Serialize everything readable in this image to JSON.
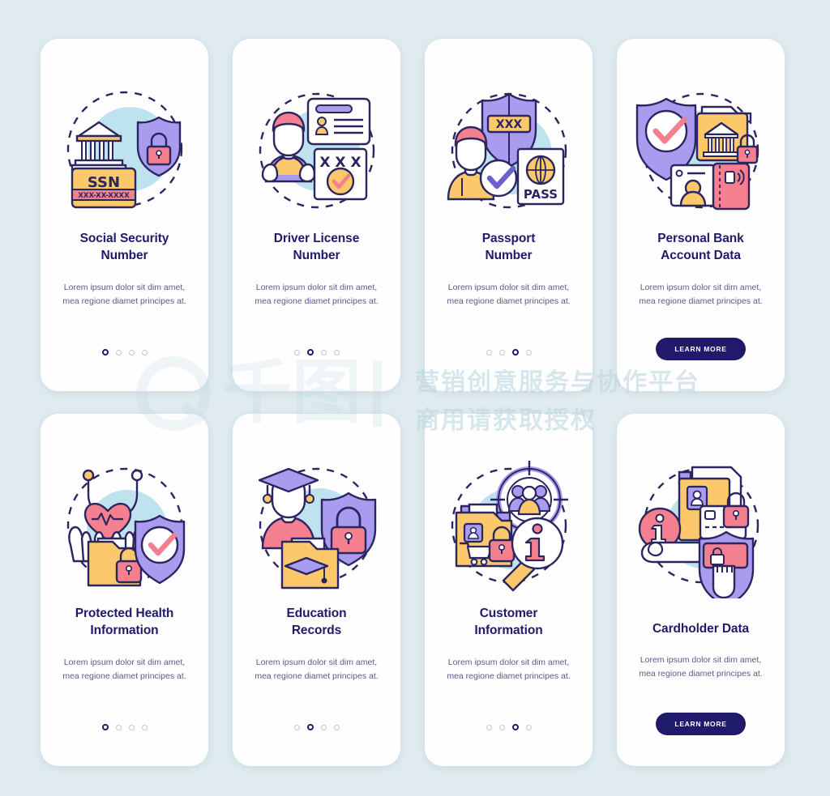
{
  "page": {
    "background_color": "#dfebef",
    "card_background": "#fefefe",
    "title_color": "#201a6b",
    "body_color": "#5b5a86",
    "accent_navy": "#201a6b",
    "accent_purple": "#9b8ee8",
    "accent_yellow": "#fbc96b",
    "accent_pink": "#f4808f",
    "accent_lightblue": "#bfe2ef"
  },
  "watermark": {
    "logo_text": "千图",
    "line1": "营销创意服务与协作平台",
    "line2": "商用请获取授权"
  },
  "shared": {
    "description": "Lorem ipsum dolor sit dim amet, mea regione diamet principes at.",
    "learn_more_label": "LEARN MORE",
    "dot_count": 4
  },
  "cards": [
    {
      "id": "social-security-number",
      "title": "Social Security Number",
      "title_lines": [
        "Social Security",
        "Number"
      ],
      "description": "Lorem ipsum dolor sit dim amet, mea regione diamet principes at.",
      "footer_type": "dots",
      "active_dot": 1,
      "illustration": "bank-ssn-card-shield-lock",
      "illustration_labels": [
        "SSN",
        "XXX-XX-XXXX"
      ]
    },
    {
      "id": "driver-license-number",
      "title": "Driver License Number",
      "title_lines": [
        "Driver License",
        "Number"
      ],
      "description": "Lorem ipsum dolor sit dim amet, mea regione diamet principes at.",
      "footer_type": "dots",
      "active_dot": 2,
      "illustration": "person-id-card-xxx-check",
      "illustration_labels": [
        "X X X"
      ]
    },
    {
      "id": "passport-number",
      "title": "Passport Number",
      "title_lines": [
        "Passport",
        "Number"
      ],
      "description": "Lorem ipsum dolor sit dim amet, mea regione diamet principes at.",
      "footer_type": "dots",
      "active_dot": 3,
      "illustration": "person-shield-xxx-passport",
      "illustration_labels": [
        "XXX",
        "PASS"
      ]
    },
    {
      "id": "personal-bank-account-data",
      "title": "Personal Bank Account Data",
      "title_lines": [
        "Personal Bank",
        "Account Data"
      ],
      "description": "Lorem ipsum dolor sit dim amet, mea regione diamet principes at.",
      "footer_type": "button",
      "button_label": "LEARN MORE",
      "illustration": "shield-check-bank-folder-lock-card",
      "illustration_labels": []
    },
    {
      "id": "protected-health-information",
      "title": "Protected Health Information",
      "title_lines": [
        "Protected Health",
        "Information"
      ],
      "description": "Lorem ipsum dolor sit dim amet, mea regione diamet principes at.",
      "footer_type": "dots",
      "active_dot": 1,
      "illustration": "hands-heart-stethoscope-folder-lock-shield",
      "illustration_labels": []
    },
    {
      "id": "education-records",
      "title": "Education Records",
      "title_lines": [
        "Education",
        "Records"
      ],
      "description": "Lorem ipsum dolor sit dim amet, mea regione diamet principes at.",
      "footer_type": "dots",
      "active_dot": 2,
      "illustration": "graduate-shield-lock-folder-cap",
      "illustration_labels": []
    },
    {
      "id": "customer-information",
      "title": "Customer Information",
      "title_lines": [
        "Customer",
        "Information"
      ],
      "description": "Lorem ipsum dolor sit dim amet, mea regione diamet principes at.",
      "footer_type": "dots",
      "active_dot": 3,
      "illustration": "target-people-folder-cart-lock-magnifier-info",
      "illustration_labels": []
    },
    {
      "id": "cardholder-data",
      "title": "Cardholder Data",
      "title_lines": [
        "Cardholder Data"
      ],
      "description": "Lorem ipsum dolor sit dim amet, mea regione diamet principes at.",
      "footer_type": "button",
      "button_label": "LEARN MORE",
      "illustration": "hand-info-folder-card-lock-shield",
      "illustration_labels": []
    }
  ]
}
